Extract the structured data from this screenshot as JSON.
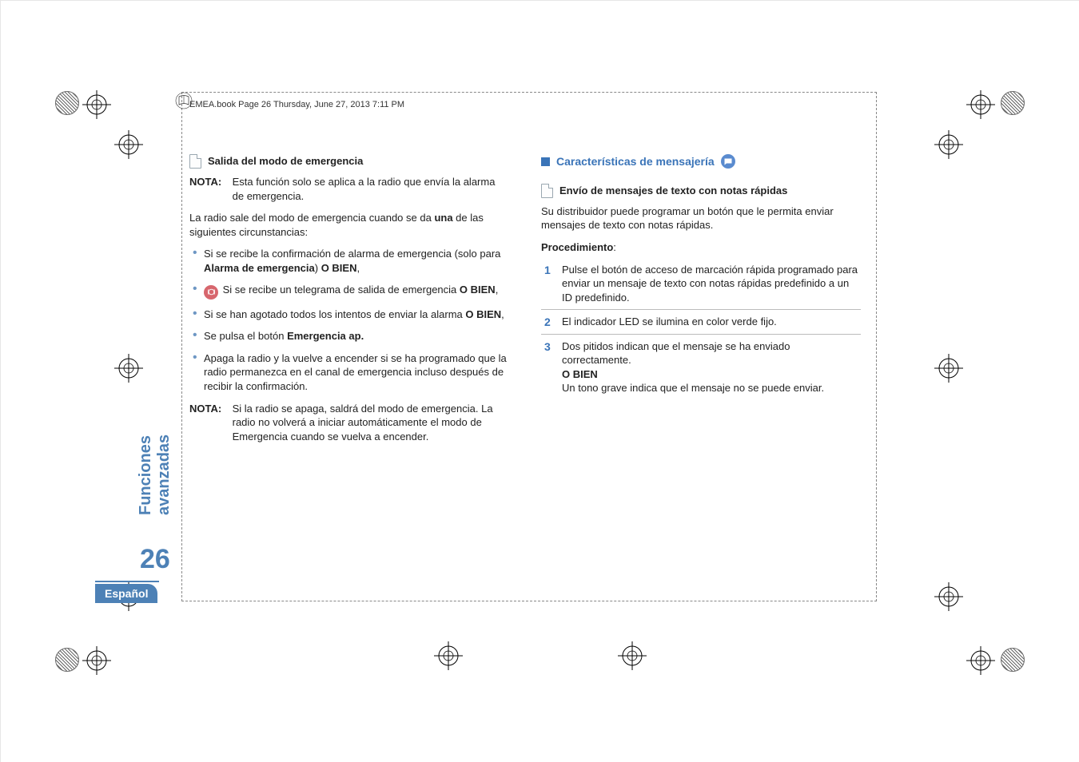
{
  "header": {
    "book_line": "EMEA.book  Page 26  Thursday, June 27, 2013  7:11 PM"
  },
  "sidebar": {
    "section": "Funciones avanzadas",
    "page_number": "26",
    "language": "Español"
  },
  "left": {
    "h1": "Salida del modo de emergencia",
    "nota1_label": "NOTA:",
    "nota1_text": "Esta función solo se aplica a la radio que envía la alarma de emergencia.",
    "intro_a": "La radio sale del modo de emergencia cuando se da ",
    "intro_b_bold": "una",
    "intro_c": " de las siguientes circunstancias:",
    "b1_a": "Si se recibe la confirmación de alarma de emergencia (solo para ",
    "b1_bold1": "Alarma de emergencia",
    "b1_mid": ") ",
    "b1_bold2": "O BIEN",
    "b1_end": ",",
    "b2_a": " Si se recibe un telegrama de salida de emergencia ",
    "b2_bold": "O BIEN",
    "b2_end": ",",
    "b3_a": "Si se han agotado todos los intentos de enviar la alarma ",
    "b3_bold": "O BIEN",
    "b3_end": ",",
    "b4_a": "Se pulsa el botón ",
    "b4_bold": "Emergencia ap.",
    "b5": "Apaga la radio y la vuelve a encender si se ha programado que la radio permanezca en el canal de emergencia incluso después de recibir la confirmación.",
    "nota2_label": "NOTA:",
    "nota2_text": "Si la radio se apaga, saldrá del modo de emergencia. La radio no volverá a iniciar automáticamente el modo de Emergencia cuando se vuelva a encender."
  },
  "right": {
    "section_title": "Características de mensajería",
    "h1": "Envío de mensajes de texto con notas rápidas",
    "intro": "Su distribuidor puede programar un botón que le permita enviar mensajes de texto con notas rápidas.",
    "proc_label_a": "Procedimiento",
    "proc_label_b": ":",
    "s1": "Pulse el botón de acceso de marcación rápida programado para enviar un mensaje de texto con notas rápidas predefinido a un ID predefinido.",
    "s2": "El indicador LED se ilumina en color verde fijo.",
    "s3_a": "Dos pitidos indican que el mensaje se ha enviado correctamente.",
    "s3_bold": "O BIEN",
    "s3_b": "Un tono grave indica que el mensaje no se puede enviar."
  },
  "colors": {
    "accent": "#4d81b6",
    "blue_dark": "#3a74b8"
  }
}
